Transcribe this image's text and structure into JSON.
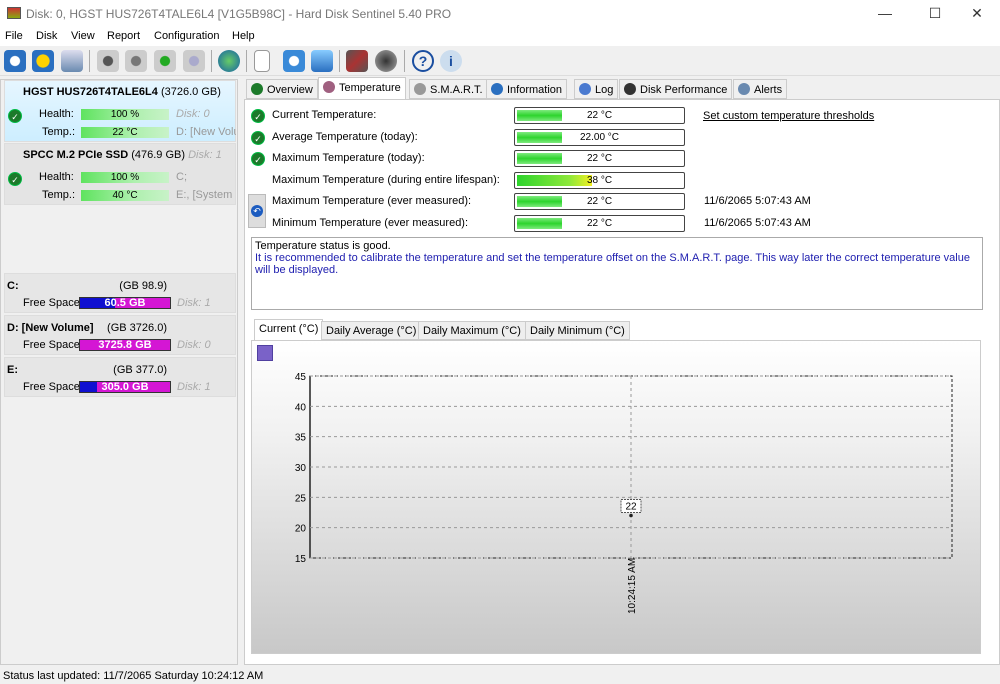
{
  "window": {
    "title": "Disk: 0, HGST HUS726T4TALE6L4 [V1G5B98C]  -  Hard Disk Sentinel 5.40 PRO",
    "minimize": "—",
    "maximize": "☐",
    "close": "✕"
  },
  "menu": [
    "File",
    "Disk",
    "View",
    "Report",
    "Configuration",
    "Help"
  ],
  "toolbar": [
    "refresh",
    "alert",
    "disk",
    "disk-tool-1",
    "disk-tool-2",
    "disk-ok",
    "disk-search",
    "globe",
    "report",
    "sync",
    "network",
    "monitor",
    "speaker",
    "help",
    "info"
  ],
  "disks": [
    {
      "name": "HGST HUS726T4TALE6L4",
      "size": "(3726.0 GB)",
      "health_label": "Health:",
      "health": "100 %",
      "health_pct": 100,
      "temp_label": "Temp.:",
      "temp": "22 °C",
      "disk": "Disk: 0",
      "drives": "D: [New Volume]",
      "extra": ""
    },
    {
      "name": "SPCC M.2 PCIe SSD",
      "size": "(476.9 GB)",
      "health_label": "Health:",
      "health": "100 %",
      "health_pct": 100,
      "temp_label": "Temp.:",
      "temp": "40 °C",
      "disk": "Disk: 1",
      "drives": "C;",
      "extra": "E:, [System Reserved]"
    }
  ],
  "volumes": [
    {
      "name": "C:",
      "size": "(98.9 GB)",
      "free_label": "Free Space",
      "free": "60.5 GB",
      "used_fraction": 0.39,
      "disk": "Disk: 1"
    },
    {
      "name": "D: [New Volume]",
      "size": "(3726.0 GB)",
      "free_label": "Free Space",
      "free": "3725.8 GB",
      "used_fraction": 0.0,
      "disk": "Disk: 0"
    },
    {
      "name": "E:",
      "size": "(377.0 GB)",
      "free_label": "Free Space",
      "free": "305.0 GB",
      "used_fraction": 0.19,
      "disk": "Disk: 1"
    }
  ],
  "tabs": [
    "Overview",
    "Temperature",
    "S.M.A.R.T.",
    "Information",
    "Log",
    "Disk Performance",
    "Alerts"
  ],
  "temps": [
    {
      "label": "Current Temperature:",
      "value": "22 °C",
      "level": 0.45,
      "ok": true
    },
    {
      "label": "Average Temperature (today):",
      "value": "22.00 °C",
      "level": 0.45,
      "ok": true
    },
    {
      "label": "Maximum Temperature (today):",
      "value": "22 °C",
      "level": 0.45,
      "ok": true
    },
    {
      "label": "Maximum Temperature (during entire lifespan):",
      "value": "38 °C",
      "level": 0.75,
      "ok": false
    },
    {
      "label": "Maximum Temperature (ever measured):",
      "value": "22 °C",
      "level": 0.45,
      "ok": false,
      "date": "11/6/2065 5:07:43 AM"
    },
    {
      "label": "Minimum Temperature (ever measured):",
      "value": "22 °C",
      "level": 0.45,
      "ok": false,
      "date": "11/6/2065 5:07:43 AM"
    }
  ],
  "threshold_link": "Set custom temperature thresholds",
  "message": {
    "status": "Temperature status is good.",
    "advice": "It is recommended to calibrate the temperature and set the temperature offset on the S.M.A.R.T. page. This way later the correct temperature value will be displayed."
  },
  "chart_tabs": [
    "Current (°C)",
    "Daily Average (°C)",
    "Daily Maximum (°C)",
    "Daily Minimum (°C)"
  ],
  "chart_data": {
    "type": "line",
    "title": "",
    "xlabel": "",
    "ylabel": "",
    "ylim": [
      15,
      45
    ],
    "yticks": [
      45,
      40,
      35,
      30,
      25,
      20,
      15
    ],
    "x": [
      "10:24:15 AM"
    ],
    "series": [
      {
        "name": "Current (°C)",
        "values": [
          22
        ]
      }
    ],
    "data_labels": [
      "22"
    ],
    "grid": true
  },
  "status": "Status last updated: 11/7/2065 Saturday 10:24:12 AM"
}
